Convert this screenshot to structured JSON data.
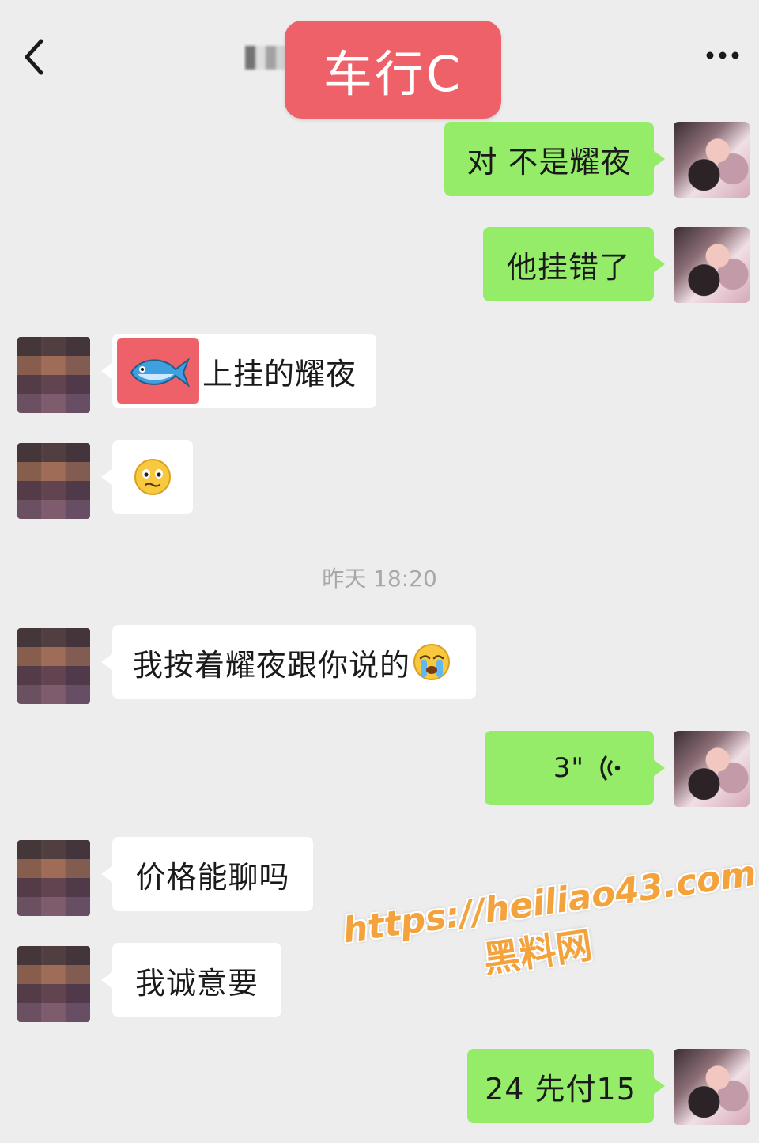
{
  "header": {
    "title": "车行C",
    "back_icon": "chevron-left-icon",
    "more_icon": "ellipsis-icon"
  },
  "messages": [
    {
      "side": "self",
      "text": "对 不是耀夜"
    },
    {
      "side": "self",
      "text": "他挂错了"
    },
    {
      "side": "other",
      "text": "上挂的耀夜",
      "icon": "fish-icon"
    },
    {
      "side": "other",
      "emoji": "awkward-face-emoji"
    },
    {
      "side": "other",
      "text": "我按着耀夜跟你说的",
      "emoji": "crying-face-emoji"
    },
    {
      "side": "self",
      "voice_duration": "3\"",
      "icon": "voice-wave-icon"
    },
    {
      "side": "other",
      "text": "价格能聊吗"
    },
    {
      "side": "other",
      "text": "我诚意要"
    },
    {
      "side": "self",
      "text": "24 先付15"
    }
  ],
  "timestamp": "昨天 18:20",
  "watermark": {
    "url": "https://heiliao43.com",
    "site": "黑料网"
  },
  "colors": {
    "background": "#ededed",
    "self_bubble": "#95ec69",
    "other_bubble": "#ffffff",
    "title_badge": "#ee6168",
    "watermark": "#f3a23c"
  }
}
